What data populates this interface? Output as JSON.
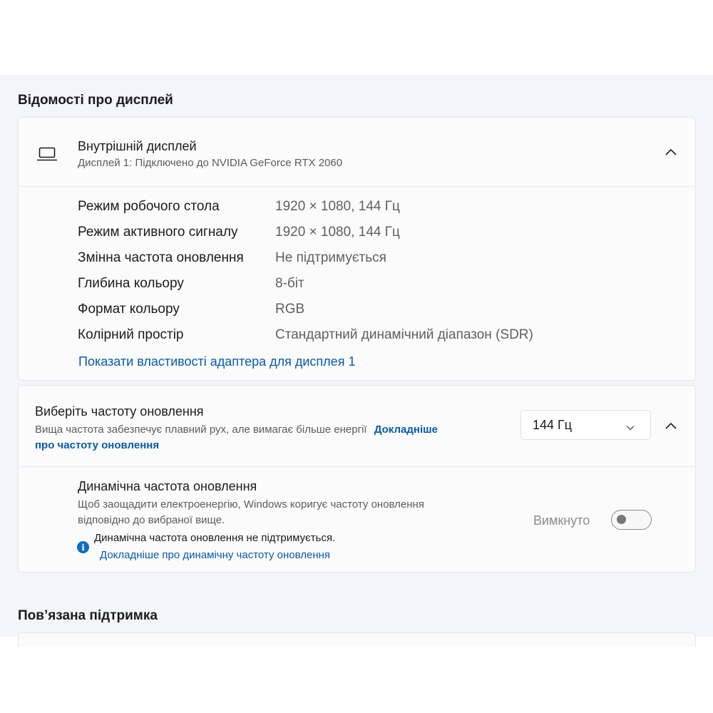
{
  "display_info": {
    "section_title": "Відомості про дисплей",
    "display_name": "Внутрішній дисплей",
    "display_subtitle": "Дисплей 1: Підключено до NVIDIA GeForce RTX 2060",
    "icon": "laptop-icon",
    "rows": [
      {
        "label": "Режим робочого стола",
        "value": "1920 × 1080, 144 Гц"
      },
      {
        "label": "Режим активного сигналу",
        "value": "1920 × 1080, 144 Гц"
      },
      {
        "label": "Змінна частота оновлення",
        "value": "Не підтримується"
      },
      {
        "label": "Глибина кольору",
        "value": "8-біт"
      },
      {
        "label": "Формат кольору",
        "value": "RGB"
      },
      {
        "label": "Колірний простір",
        "value": "Стандартний динамічний діапазон (SDR)"
      }
    ],
    "adapter_link": "Показати властивості адаптера для дисплея 1"
  },
  "refresh_rate": {
    "title": "Виберіть частоту оновлення",
    "description": "Вища частота забезпечує плавний рух, але вимагає більше енергії",
    "learn_more_part1": "Докладніше",
    "learn_more_part2": "про частоту оновлення",
    "selected": "144 Гц",
    "dynamic": {
      "title": "Динамічна частота оновлення",
      "desc_line1": "Щоб заощадити електроенергію, Windows коригує частоту оновлення",
      "desc_line2": "відповідно до вибраної вище.",
      "warning": "Динамічна частота оновлення не підтримується.",
      "warning_link": "Докладніше про динамічну частоту оновлення",
      "toggle_state": "Вимкнуто",
      "toggle_on": false
    }
  },
  "related_support": {
    "section_title": "Пов’язана підтримка"
  },
  "colors": {
    "accent": "#0f6cbd",
    "link": "#0a5aa8",
    "panel_bg": "#f3f5fa"
  }
}
